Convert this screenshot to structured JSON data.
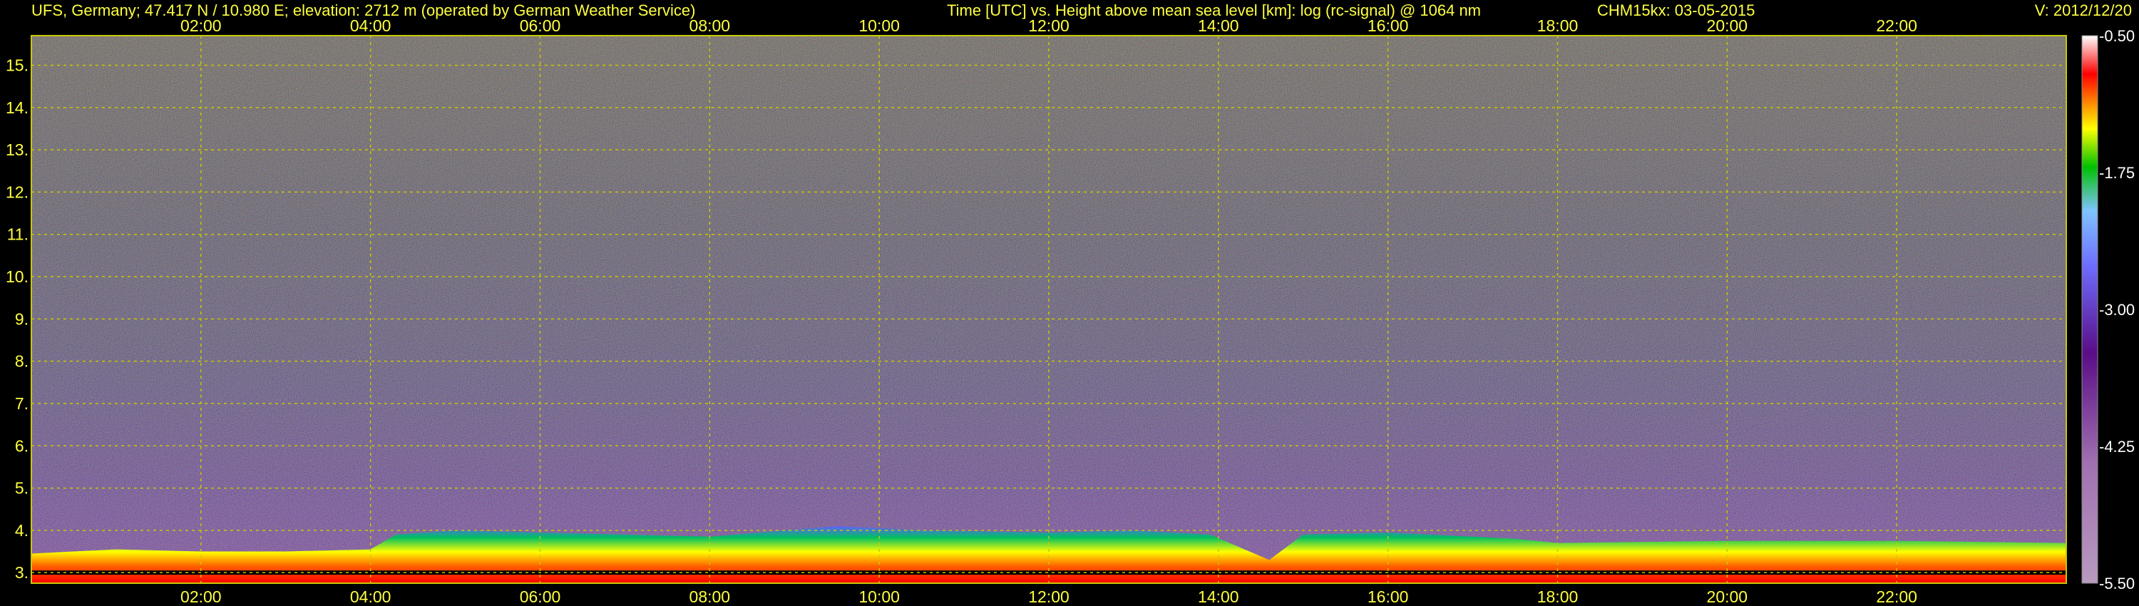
{
  "header": {
    "station": "UFS, Germany; 47.417 N / 10.980 E; elevation: 2712 m  (operated by German Weather Service)",
    "axes_title": "Time [UTC] vs. Height above mean sea level [km]: log (rc-signal) @ 1064 nm",
    "instrument_date": "CHM15kx: 03-05-2015",
    "version": "V: 2012/12/20"
  },
  "colors": {
    "background": "#000000",
    "text": "#ffff40",
    "grid": "#c8c800",
    "colorbar_stops": [
      "#b89ac0",
      "#a070b0",
      "#5a0d86",
      "#6d6dff",
      "#7fc4ff",
      "#00c000",
      "#ffff00",
      "#ff8000",
      "#ff0000",
      "#ffffff"
    ]
  },
  "chart_data": {
    "type": "heatmap",
    "title": "Time [UTC] vs. Height above mean sea level [km]: log (rc-signal) @ 1064 nm",
    "xlabel": "Time [UTC]",
    "ylabel": "Height above mean sea level [km]",
    "xlim": [
      0,
      24
    ],
    "ylim": [
      2.75,
      15.7
    ],
    "x_ticks": [
      "02:00",
      "04:00",
      "06:00",
      "08:00",
      "10:00",
      "12:00",
      "14:00",
      "16:00",
      "18:00",
      "20:00",
      "22:00"
    ],
    "x_tick_values": [
      2,
      4,
      6,
      8,
      10,
      12,
      14,
      16,
      18,
      20,
      22
    ],
    "y_ticks": [
      "3.",
      "4.",
      "5.",
      "6.",
      "7.",
      "8.",
      "9.",
      "10.",
      "11.",
      "12.",
      "13.",
      "14.",
      "15."
    ],
    "y_tick_values": [
      3,
      4,
      5,
      6,
      7,
      8,
      9,
      10,
      11,
      12,
      13,
      14,
      15
    ],
    "grid": true,
    "colorbar": {
      "range": [
        -5.5,
        -0.5
      ],
      "labels": [
        "-0.50",
        "-1.75",
        "-3.00",
        "-4.25",
        "-5.50"
      ],
      "label_values": [
        -0.5,
        -1.75,
        -3.0,
        -4.25,
        -5.5
      ],
      "placement": "right"
    },
    "aerosol_layer_top_km": [
      [
        0.0,
        3.45
      ],
      [
        1.0,
        3.55
      ],
      [
        2.0,
        3.5
      ],
      [
        3.0,
        3.5
      ],
      [
        4.0,
        3.55
      ],
      [
        4.3,
        3.9
      ],
      [
        5.0,
        4.0
      ],
      [
        6.0,
        3.95
      ],
      [
        7.0,
        3.9
      ],
      [
        8.0,
        3.85
      ],
      [
        9.5,
        4.1
      ],
      [
        10.5,
        4.0
      ],
      [
        12.0,
        3.95
      ],
      [
        13.0,
        4.0
      ],
      [
        13.9,
        3.9
      ],
      [
        14.6,
        3.3
      ],
      [
        15.0,
        3.9
      ],
      [
        16.0,
        3.95
      ],
      [
        17.5,
        3.8
      ],
      [
        18.0,
        3.7
      ],
      [
        20.0,
        3.75
      ],
      [
        22.0,
        3.75
      ],
      [
        24.0,
        3.7
      ]
    ]
  }
}
